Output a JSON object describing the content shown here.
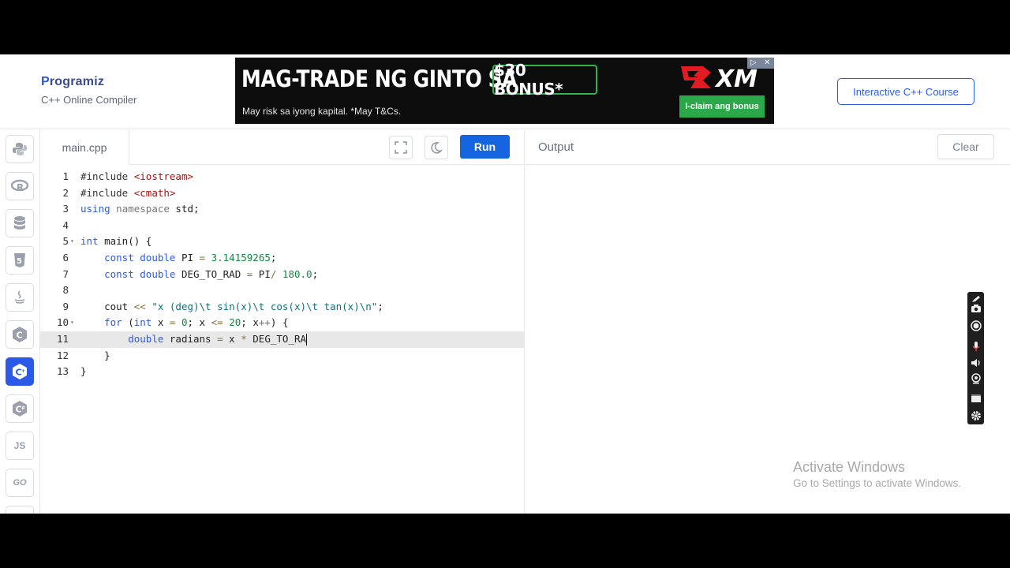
{
  "header": {
    "logo_text": "rogramiz",
    "logo_initial": "P",
    "subtitle": "C++ Online Compiler",
    "course_button": "Interactive C++ Course"
  },
  "ad": {
    "headline": "MAG-TRADE NG GINTO SA",
    "bonus": "$30 BONUS*",
    "risk_text": "May risk sa iyong kapital. *May T&Cs.",
    "brand": "XM",
    "cta": "I-claim ang bonus",
    "colors": {
      "background": "#0d0d0d",
      "accent_green": "#2aa84a",
      "brand_red": "#e21b23"
    }
  },
  "sidebar": {
    "items": [
      {
        "name": "python-icon",
        "label": ""
      },
      {
        "name": "r-icon",
        "label": ""
      },
      {
        "name": "sql-icon",
        "label": ""
      },
      {
        "name": "html5-icon",
        "label": ""
      },
      {
        "name": "java-icon",
        "label": ""
      },
      {
        "name": "c-icon",
        "label": ""
      },
      {
        "name": "cpp-icon",
        "label": "",
        "active": true
      },
      {
        "name": "csharp-icon",
        "label": ""
      },
      {
        "name": "js-icon",
        "label": "JS"
      },
      {
        "name": "go-icon",
        "label": "GO"
      }
    ]
  },
  "editor": {
    "filename": "main.cpp",
    "run_label": "Run",
    "active_line": 11,
    "lines": [
      {
        "n": "1",
        "code": "#include <iostream>"
      },
      {
        "n": "2",
        "code": "#include <cmath>"
      },
      {
        "n": "3",
        "code": "using namespace std;"
      },
      {
        "n": "4",
        "code": ""
      },
      {
        "n": "5",
        "code": "int main() {",
        "fold": true
      },
      {
        "n": "6",
        "code": "    const double PI = 3.14159265;"
      },
      {
        "n": "7",
        "code": "    const double DEG_TO_RAD = PI/ 180.0;"
      },
      {
        "n": "8",
        "code": ""
      },
      {
        "n": "9",
        "code": "    cout << \"x (deg)\\t sin(x)\\t cos(x)\\t tan(x)\\n\";"
      },
      {
        "n": "10",
        "code": "    for (int x = 0; x <= 20; x++) {",
        "fold": true
      },
      {
        "n": "11",
        "code": "        double radians = x * DEG_TO_RA"
      },
      {
        "n": "12",
        "code": "    }"
      },
      {
        "n": "13",
        "code": "}"
      }
    ]
  },
  "output": {
    "title": "Output",
    "clear_label": "Clear"
  },
  "recorder": {
    "items": [
      "pen-icon",
      "camera-icon",
      "record-icon",
      "microphone-icon",
      "speaker-icon",
      "webcam-icon",
      "window-icon",
      "settings-icon"
    ]
  },
  "watermark": {
    "line1": "Activate Windows",
    "line2": "Go to Settings to activate Windows."
  }
}
